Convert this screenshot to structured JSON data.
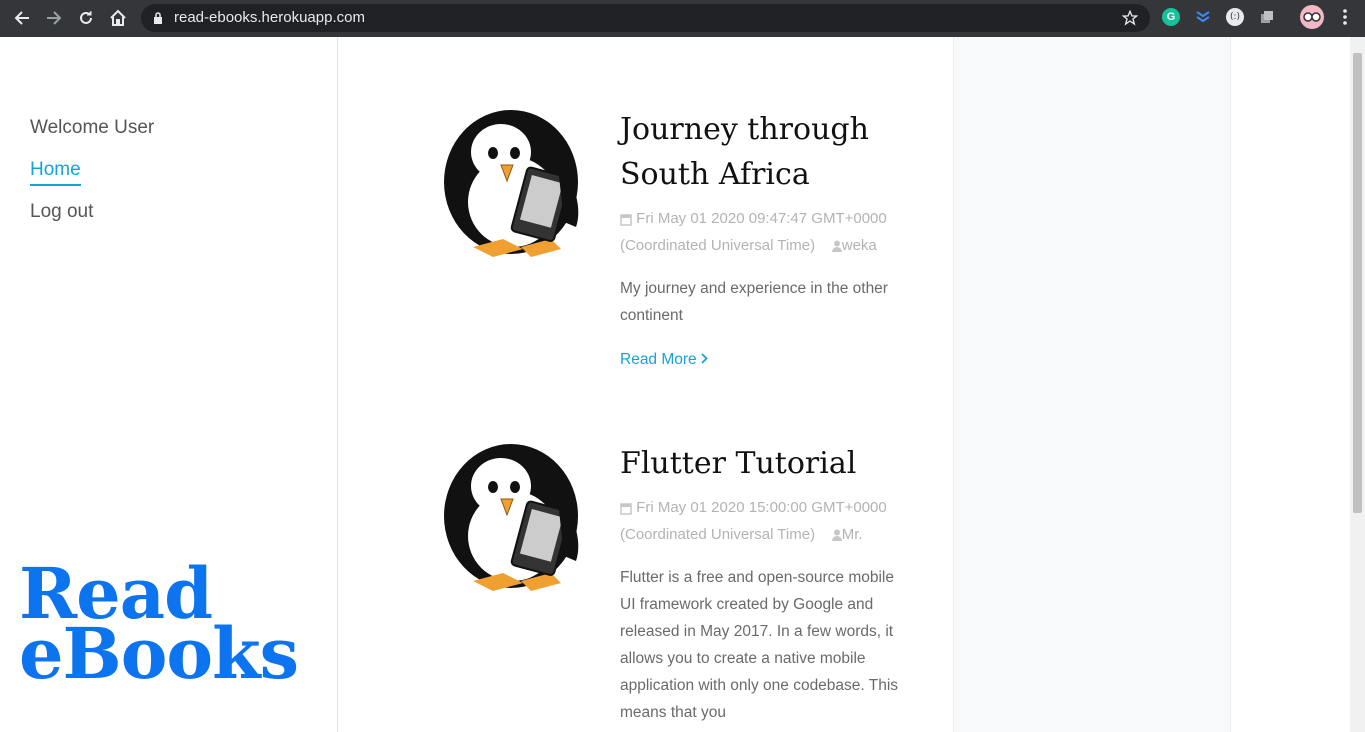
{
  "browser": {
    "url": "read-ebooks.herokuapp.com"
  },
  "sidebar": {
    "items": [
      {
        "label": "Welcome User"
      },
      {
        "label": "Home"
      },
      {
        "label": "Log out"
      }
    ],
    "logo_line1": "Read",
    "logo_line2": "eBooks"
  },
  "posts": [
    {
      "title": "Journey through South Africa",
      "date": "Fri May 01 2020 09:47:47 GMT+0000 (Coordinated Universal Time)",
      "author": "weka",
      "excerpt": "My journey and experience in the other continent",
      "read_more": "Read More"
    },
    {
      "title": "Flutter Tutorial",
      "date": "Fri May 01 2020 15:00:00 GMT+0000 (Coordinated Universal Time)",
      "author": "Mr.",
      "excerpt": "Flutter is a free and open-source mobile UI framework created by Google and released in May 2017. In a few words, it allows you to create a native mobile application with only one codebase. This means that you"
    }
  ],
  "colors": {
    "accent": "#17a2d8",
    "logo": "#0d74f0"
  }
}
